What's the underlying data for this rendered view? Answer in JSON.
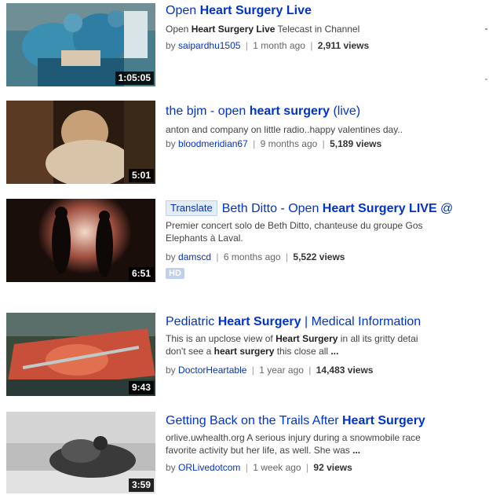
{
  "results": [
    {
      "title_parts": [
        {
          "t": "Open ",
          "b": false
        },
        {
          "t": "Heart Surgery Live",
          "b": true
        }
      ],
      "desc_lines": [
        [
          {
            "t": "Open ",
            "b": false
          },
          {
            "t": "Heart Surgery Live",
            "b": true
          },
          {
            "t": " Telecast in Channel",
            "b": false
          }
        ]
      ],
      "user": "saipardhu1505",
      "age": "1 month ago",
      "views": "2,911 views",
      "duration": "1:05:05",
      "translate": null,
      "hd": null
    },
    {
      "title_parts": [
        {
          "t": "the bjm - open ",
          "b": false
        },
        {
          "t": "heart surgery",
          "b": true
        },
        {
          "t": " (live)",
          "b": false
        }
      ],
      "desc_lines": [
        [
          {
            "t": "anton and company on little radio..happy valentines day..",
            "b": false
          }
        ]
      ],
      "user": "bloodmeridian67",
      "age": "9 months ago",
      "views": "5,189 views",
      "duration": "5:01",
      "translate": null,
      "hd": null
    },
    {
      "title_parts": [
        {
          "t": "Beth Ditto - Open ",
          "b": false
        },
        {
          "t": "Heart Surgery LIVE",
          "b": true
        },
        {
          "t": " @",
          "b": false
        }
      ],
      "desc_lines": [
        [
          {
            "t": "Premier concert solo de Beth Ditto, chanteuse du groupe Gos",
            "b": false
          }
        ],
        [
          {
            "t": "Elephants à Laval.",
            "b": false
          }
        ]
      ],
      "user": "damscd",
      "age": "6 months ago",
      "views": "5,522 views",
      "duration": "6:51",
      "translate": "Translate",
      "hd": "HD"
    },
    {
      "title_parts": [
        {
          "t": "Pediatric ",
          "b": false
        },
        {
          "t": "Heart Surgery",
          "b": true
        },
        {
          "t": " | Medical Information",
          "b": false
        }
      ],
      "desc_lines": [
        [
          {
            "t": "This is an upclose view of ",
            "b": false
          },
          {
            "t": "Heart Surgery",
            "b": true
          },
          {
            "t": " in all its gritty detai",
            "b": false
          }
        ],
        [
          {
            "t": "don't see a ",
            "b": false
          },
          {
            "t": "heart surgery",
            "b": true
          },
          {
            "t": " this close all ",
            "b": false
          },
          {
            "t": "...",
            "b": true
          }
        ]
      ],
      "user": "DoctorHeartable",
      "age": "1 year ago",
      "views": "14,483 views",
      "duration": "9:43",
      "translate": null,
      "hd": null
    },
    {
      "title_parts": [
        {
          "t": "Getting Back on the Trails After ",
          "b": false
        },
        {
          "t": "Heart Surgery",
          "b": true
        }
      ],
      "desc_lines": [
        [
          {
            "t": "orlive.uwhealth.org A serious injury during a snowmobile race",
            "b": false
          }
        ],
        [
          {
            "t": "favorite activity but her life, as well. She was ",
            "b": false
          },
          {
            "t": "...",
            "b": true
          }
        ]
      ],
      "user": "ORLivedotcom",
      "age": "1 week ago",
      "views": "92 views",
      "duration": "3:59",
      "translate": null,
      "hd": null
    }
  ],
  "colors": {
    "link": "#0033cc",
    "text": "#444444",
    "meta": "#666666"
  },
  "labels": {
    "by": "by",
    "separator": "|"
  }
}
